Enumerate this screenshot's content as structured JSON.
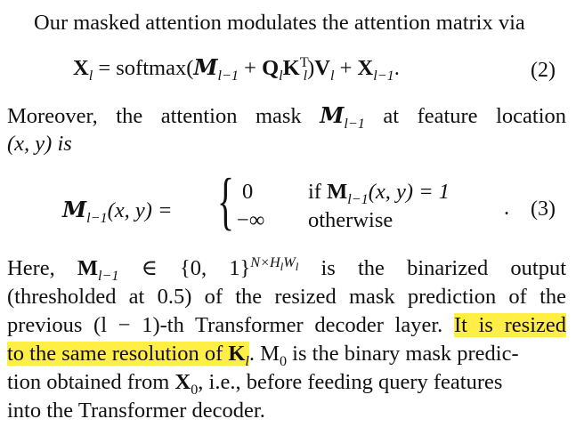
{
  "intro_line": "Our masked attention modulates the attention matrix via",
  "eq2": {
    "lhs": "X",
    "equals_fn": "= softmax(",
    "plus": "+",
    "close": ")",
    "number": "(2)"
  },
  "para1": {
    "line1_start": "Moreover, the attention mask",
    "line1_end": "at feature location",
    "line2": "(x, y) is"
  },
  "eq3": {
    "lhs": "(x, y) =",
    "case1_value": "0",
    "case1_cond": "if",
    "case1_cond_rest": "(x, y) = 1",
    "case2_value": "−∞",
    "case2_cond": "otherwise",
    "period": ".",
    "number": "(3)"
  },
  "para2": {
    "line1_a": "Here,",
    "line1_b": "∈ {0, 1}",
    "line1_c": "is the binarized output",
    "line2": "(thresholded at 0.5) of the resized mask prediction of the",
    "line3_a": "previous (l − 1)-th Transformer decoder layer.",
    "line3_hl": "It is resized",
    "line4_hl_a": "to the same resolution of",
    "line4_rest": ". M",
    "line4_rest2": "is the binary mask predic-",
    "line5_a": "tion obtained from",
    "line5_b": ", i.e., before feeding query features",
    "line6": "into the Transformer decoder."
  }
}
